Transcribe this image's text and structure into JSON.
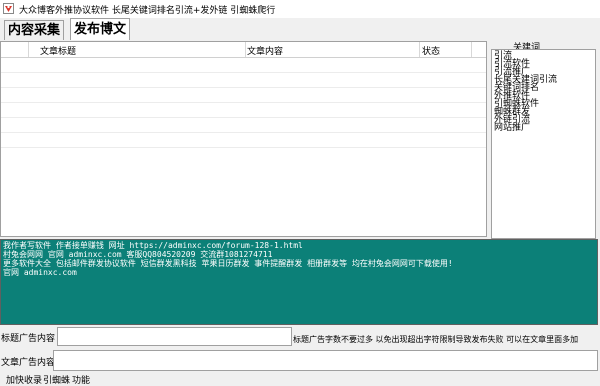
{
  "window": {
    "title": "大众博客外推协议软件 长尾关键词排名引流+发外链 引蜘蛛爬行",
    "icon": "app-icon"
  },
  "tabs": [
    {
      "label": "内容采集"
    },
    {
      "label": "发布博文"
    }
  ],
  "table": {
    "columns": [
      "文章标题",
      "文章内容",
      "状态"
    ]
  },
  "keywords": {
    "label": "关建词",
    "items": [
      "引流",
      "引流软件",
      "引流推广",
      "长尾关建词引流",
      "关键词排名",
      "外推软件",
      "引蜘蛛软件",
      "蜘蛛群发",
      "外链引流",
      "网站推广"
    ]
  },
  "log": {
    "lines": [
      "我作者写软件 作者接单赚钱 网址 https://adminxc.com/forum-128-1.html",
      "     村兔会网网 官网 adminxc.com 客服QQ804520209  交流群1081274711",
      "更多软件大全 包括邮件群发协议软件  短信群发黑科技 苹果日历群发 事件提醒群发 相册群发等 均在村兔会网网可下载使用!",
      "官网 adminxc.com"
    ]
  },
  "ad_title": {
    "label": "标题广告内容",
    "value": "",
    "hint": "标题广告字数不要过多 以免出现超出字符限制导致发布失败  可以在文章里面多加"
  },
  "ad_content": {
    "label": "文章广告内容",
    "value": ""
  },
  "footer_tabs": [
    {
      "label": "加快收录"
    },
    {
      "label": "引蜘蛛"
    },
    {
      "label": "功能"
    }
  ]
}
